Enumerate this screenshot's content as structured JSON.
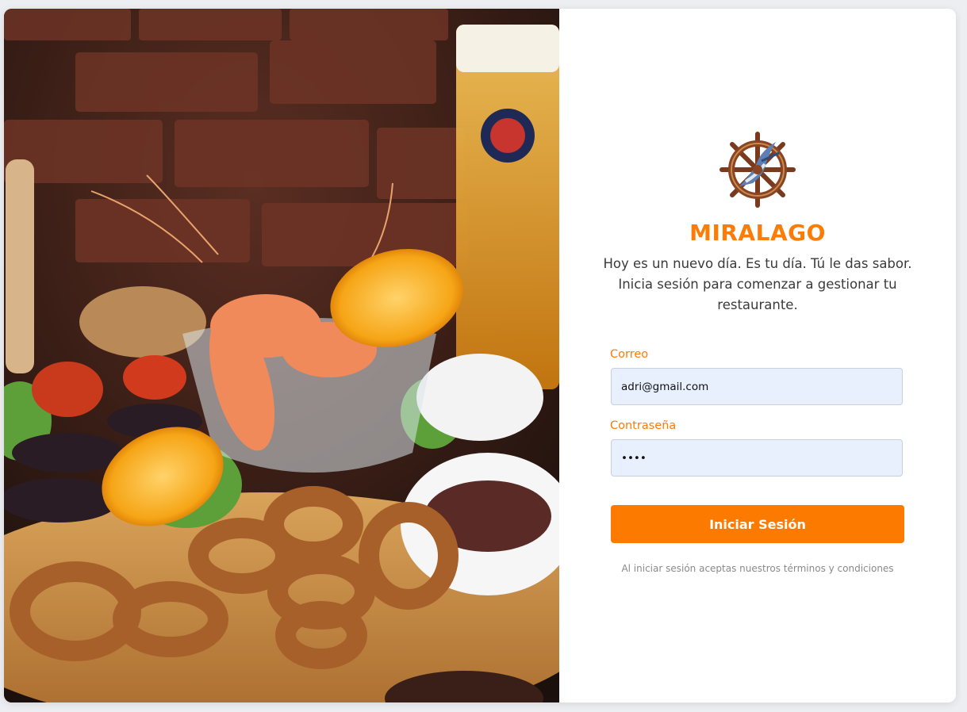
{
  "brand": {
    "name": "MIRALAGO",
    "accent_color": "#fb7c06"
  },
  "hero": {
    "image_icon": "seafood-platter-photo"
  },
  "login": {
    "subtitle": "Hoy es un nuevo día. Es tu día. Tú le das sabor. Inicia sesión para comenzar a gestionar tu restaurante.",
    "email_label": "Correo",
    "email_value": "adri@gmail.com",
    "password_label": "Contraseña",
    "password_value": "••••",
    "submit_label": "Iniciar Sesión",
    "terms_text": "Al iniciar sesión aceptas nuestros términos y condiciones"
  }
}
